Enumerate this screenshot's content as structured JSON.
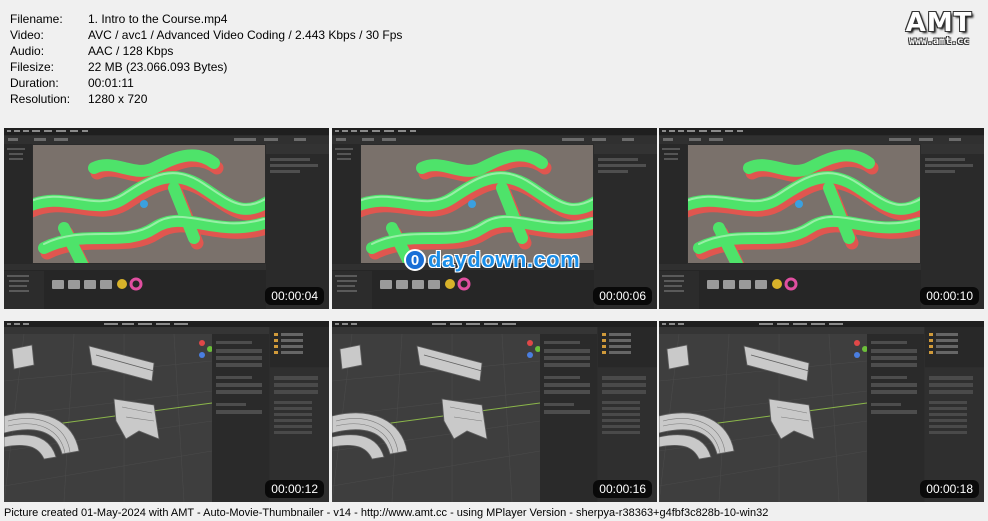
{
  "info": [
    {
      "key": "Filename:",
      "value": "1. Intro to the Course.mp4"
    },
    {
      "key": "Video:",
      "value": "AVC / avc1 / Advanced Video Coding / 2.443 Kbps / 30 Fps"
    },
    {
      "key": "Audio:",
      "value": "AAC / 128 Kbps"
    },
    {
      "key": "Filesize:",
      "value": "22 MB (23.066.093 Bytes)"
    },
    {
      "key": "Duration:",
      "value": "00:01:11"
    },
    {
      "key": "Resolution:",
      "value": "1280 x 720"
    }
  ],
  "logo": {
    "mark": "AMT",
    "url": "www.amt.cc"
  },
  "thumbnails": [
    {
      "timestamp": "00:00:04",
      "kind": "render"
    },
    {
      "timestamp": "00:00:06",
      "kind": "render"
    },
    {
      "timestamp": "00:00:10",
      "kind": "render"
    },
    {
      "timestamp": "00:00:12",
      "kind": "modeling"
    },
    {
      "timestamp": "00:00:16",
      "kind": "modeling"
    },
    {
      "timestamp": "00:00:18",
      "kind": "modeling"
    }
  ],
  "watermark": {
    "glyph": "0",
    "text": "daydown.com"
  },
  "footer": "Picture created 01-May-2024 with AMT - Auto-Movie-Thumbnailer - v14 - http://www.amt.cc - using MPlayer Version - sherpya-r38363+g4fbf3c828b-10-win32",
  "colors": {
    "track_green": "#4ee36a",
    "track_red": "#e0564f",
    "viewport_bg": "#7a716b",
    "ui_dark": "#2b2b2b"
  }
}
